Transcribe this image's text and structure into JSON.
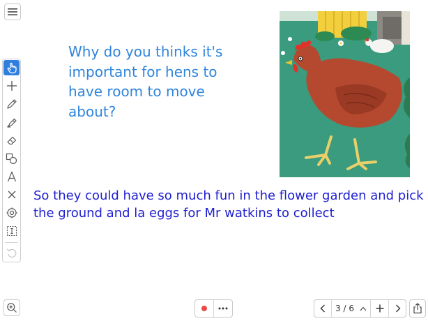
{
  "question": {
    "lines": [
      "Why do you thinks it's",
      "important for hens to",
      "have room to move",
      "about?"
    ]
  },
  "answer": {
    "lines": [
      "So they could have so much fun in the flower garden and pick",
      "the ground and la eggs for Mr watkins to collect"
    ]
  },
  "toolbar": {
    "tools": [
      "hand-select",
      "add",
      "pen",
      "highlighter",
      "eraser",
      "shapes",
      "text",
      "delete",
      "target",
      "text-box",
      "undo"
    ],
    "active_tool": "hand-select"
  },
  "pager": {
    "indicator": "3 / 6"
  },
  "colors": {
    "question_text": "#2f85dc",
    "answer_text": "#1e1ed0",
    "active_tool": "#2f7fe0",
    "record_dot": "#e84a4a"
  }
}
